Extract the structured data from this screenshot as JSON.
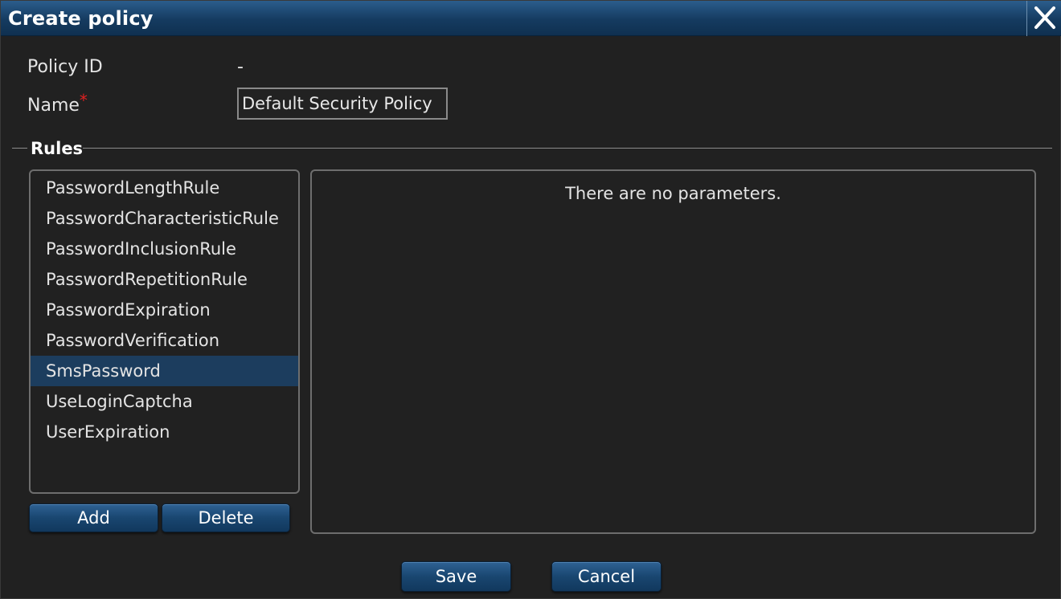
{
  "window": {
    "title": "Create policy",
    "close_icon": "close-icon"
  },
  "form": {
    "policy_id_label": "Policy ID",
    "policy_id_value": "-",
    "name_label": "Name",
    "name_required_marker": "*",
    "name_value": "Default Security Policy"
  },
  "rules": {
    "legend": "Rules",
    "items": [
      "PasswordLengthRule",
      "PasswordCharacteristicRule",
      "PasswordInclusionRule",
      "PasswordRepetitionRule",
      "PasswordExpiration",
      "PasswordVerification",
      "SmsPassword",
      "UseLoginCaptcha",
      "UserExpiration"
    ],
    "selected": "SmsPassword",
    "add_label": "Add",
    "delete_label": "Delete"
  },
  "parameters": {
    "empty_message": "There are no parameters."
  },
  "footer": {
    "save_label": "Save",
    "cancel_label": "Cancel"
  },
  "colors": {
    "title_bar": "#153b60",
    "selection": "#1c3d5e",
    "required": "#e02020",
    "button": "#194670"
  }
}
